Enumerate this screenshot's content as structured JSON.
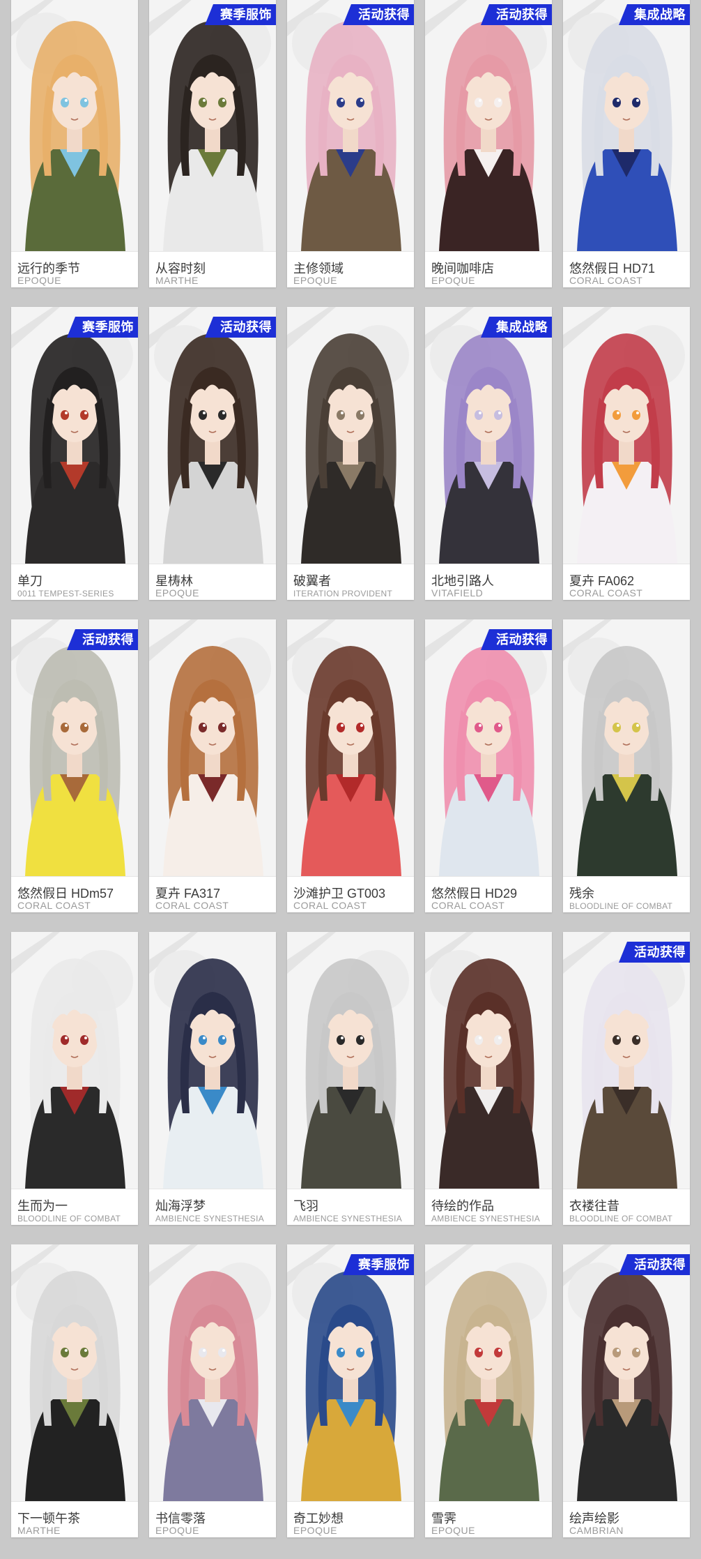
{
  "colors": {
    "background": "#c9c9c9",
    "badge": "#1d2fd6",
    "card": "#ffffff"
  },
  "rows": [
    {
      "cards": [
        {
          "name": "远行的季节",
          "series": "EPOQUE",
          "badge": "",
          "hair": "#e8b06a",
          "outfit": "#5a6b3a",
          "accent": "#7fc3e0",
          "icon": "portrait-art"
        },
        {
          "name": "从容时刻",
          "series": "MARTHE",
          "badge": "赛季服饰",
          "hair": "#2b2420",
          "outfit": "#e9e9e9",
          "accent": "#6b7a3a",
          "icon": "portrait-art"
        },
        {
          "name": "主修领域",
          "series": "EPOQUE",
          "badge": "活动获得",
          "hair": "#e8b2c4",
          "outfit": "#6e5a44",
          "accent": "#2b3c8a",
          "icon": "portrait-art"
        },
        {
          "name": "晚间咖啡店",
          "series": "EPOQUE",
          "badge": "活动获得",
          "hair": "#e69aa6",
          "outfit": "#3a2424",
          "accent": "#f5f0ef",
          "icon": "portrait-art"
        },
        {
          "name": "悠然假日 HD71",
          "series": "CORAL COAST",
          "badge": "集成战略",
          "hair": "#d9dde6",
          "outfit": "#2f4fb8",
          "accent": "#1e2a6a",
          "icon": "portrait-art"
        }
      ]
    },
    {
      "cards": [
        {
          "name": "单刀",
          "series": "0011 TEMPEST-SERIES",
          "badge": "赛季服饰",
          "hair": "#222020",
          "outfit": "#2c2a2a",
          "accent": "#b33a2a",
          "icon": "portrait-art"
        },
        {
          "name": "星梼林",
          "series": "EPOQUE",
          "badge": "活动获得",
          "hair": "#3a2a22",
          "outfit": "#d4d4d4",
          "accent": "#2a2a2a",
          "icon": "portrait-art"
        },
        {
          "name": "破翼者",
          "series": "ITERATION PROVIDENT",
          "badge": "",
          "hair": "#4a3f36",
          "outfit": "#2f2b28",
          "accent": "#8a7a66",
          "icon": "portrait-art"
        },
        {
          "name": "北地引路人",
          "series": "VITAFIELD",
          "badge": "集成战略",
          "hair": "#9b86c8",
          "outfit": "#34323a",
          "accent": "#c6bde0",
          "icon": "portrait-art"
        },
        {
          "name": "夏卉 FA062",
          "series": "CORAL COAST",
          "badge": "",
          "hair": "#c23d4a",
          "outfit": "#f4f0f4",
          "accent": "#f29c3c",
          "icon": "portrait-art"
        }
      ]
    },
    {
      "cards": [
        {
          "name": "悠然假日 HDm57",
          "series": "CORAL COAST",
          "badge": "活动获得",
          "hair": "#bdbdb2",
          "outfit": "#f0e040",
          "accent": "#a86a3a",
          "icon": "portrait-art"
        },
        {
          "name": "夏卉 FA317",
          "series": "CORAL COAST",
          "badge": "",
          "hair": "#b5703e",
          "outfit": "#f6eee8",
          "accent": "#7a2a2a",
          "icon": "portrait-art"
        },
        {
          "name": "沙滩护卫 GT003",
          "series": "CORAL COAST",
          "badge": "",
          "hair": "#6a3a2c",
          "outfit": "#e45a5a",
          "accent": "#b22a2a",
          "icon": "portrait-art"
        },
        {
          "name": "悠然假日 HD29",
          "series": "CORAL COAST",
          "badge": "活动获得",
          "hair": "#ef8fae",
          "outfit": "#dfe6ee",
          "accent": "#e05a8a",
          "icon": "portrait-art"
        },
        {
          "name": "残余",
          "series": "BLOODLINE OF COMBAT",
          "badge": "",
          "hair": "#c8c8c8",
          "outfit": "#2d3a2e",
          "accent": "#d4c44a",
          "icon": "portrait-art"
        }
      ]
    },
    {
      "cards": [
        {
          "name": "生而为一",
          "series": "BLOODLINE OF COMBAT",
          "badge": "",
          "hair": "#eaeaea",
          "outfit": "#2a2a2a",
          "accent": "#a02a2a",
          "icon": "portrait-art"
        },
        {
          "name": "灿海浮梦",
          "series": "AMBIENCE SYNESTHESIA",
          "badge": "",
          "hair": "#2a2e48",
          "outfit": "#e8eef2",
          "accent": "#3a8ac8",
          "icon": "portrait-art"
        },
        {
          "name": "飞羽",
          "series": "AMBIENCE SYNESTHESIA",
          "badge": "",
          "hair": "#c8c8c8",
          "outfit": "#4a4a40",
          "accent": "#2a2a2a",
          "icon": "portrait-art"
        },
        {
          "name": "待绘的作品",
          "series": "AMBIENCE SYNESTHESIA",
          "badge": "",
          "hair": "#5a3028",
          "outfit": "#3a2a28",
          "accent": "#f0eeee",
          "icon": "portrait-art"
        },
        {
          "name": "衣褛往昔",
          "series": "BLOODLINE OF COMBAT",
          "badge": "活动获得",
          "hair": "#e8e4ee",
          "outfit": "#5a4a3a",
          "accent": "#3a2e28",
          "icon": "portrait-art"
        }
      ]
    },
    {
      "cards": [
        {
          "name": "下一顿午茶",
          "series": "MARTHE",
          "badge": "",
          "hair": "#d8d8d8",
          "outfit": "#222222",
          "accent": "#6a7a3a",
          "icon": "portrait-art"
        },
        {
          "name": "书信零落",
          "series": "EPOQUE",
          "badge": "",
          "hair": "#d88a96",
          "outfit": "#7e7a9e",
          "accent": "#e8e8ee",
          "icon": "portrait-art"
        },
        {
          "name": "奇工妙想",
          "series": "EPOQUE",
          "badge": "赛季服饰",
          "hair": "#2a4a8a",
          "outfit": "#d8a83a",
          "accent": "#3a8ac8",
          "icon": "portrait-art"
        },
        {
          "name": "雪霁",
          "series": "EPOQUE",
          "badge": "",
          "hair": "#c8b490",
          "outfit": "#5a6a4a",
          "accent": "#c23a3a",
          "icon": "portrait-art"
        },
        {
          "name": "绘声绘影",
          "series": "CAMBRIAN",
          "badge": "活动获得",
          "hair": "#4a3030",
          "outfit": "#2a2a2a",
          "accent": "#b89a7a",
          "icon": "portrait-art"
        }
      ]
    }
  ]
}
